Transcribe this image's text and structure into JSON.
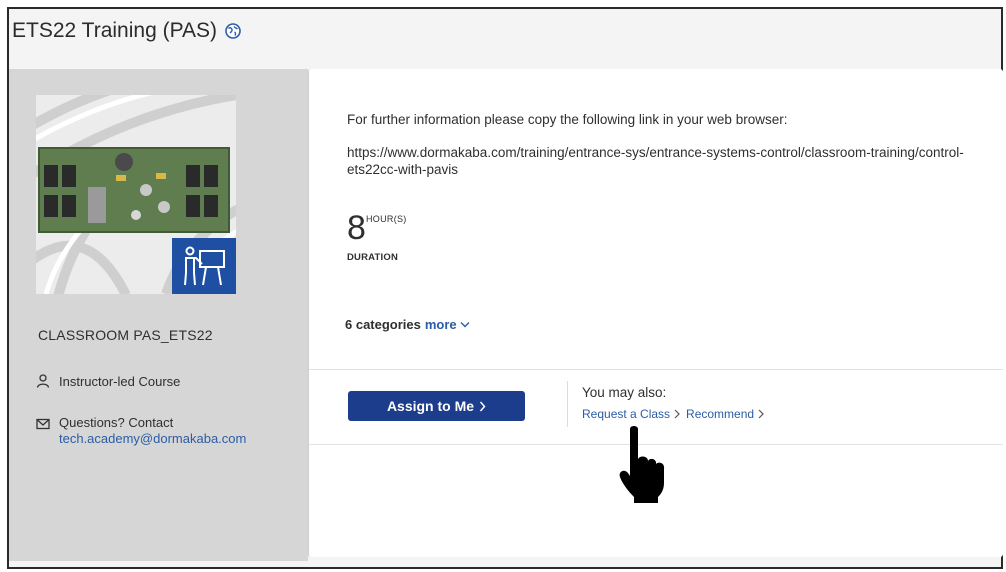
{
  "header": {
    "title": "ETS22 Training (PAS)",
    "icon": "globe-icon"
  },
  "sidebar": {
    "course_id": "CLASSROOM PAS_ETS22",
    "delivery_type": "Instructor-led Course",
    "questions_label": "Questions? Contact",
    "contact_email": "tech.academy@dormakaba.com"
  },
  "main": {
    "info_text": "For further information please copy the following link in your web browser:",
    "link_text": "https://www.dormakaba.com/training/entrance-sys/entrance-systems-control/classroom-training/control-ets22cc-with-pavis",
    "duration_value": "8",
    "duration_unit": "HOUR(S)",
    "duration_label": "DURATION",
    "categories_label": "6 categories",
    "more_label": "more"
  },
  "actions": {
    "assign_label": "Assign to Me",
    "may_also_label": "You may also:",
    "request_label": "Request a Class",
    "recommend_label": "Recommend"
  },
  "colors": {
    "primary_button": "#1b3d8b",
    "link": "#2a5da6",
    "sidebar_bg": "#d6d6d6",
    "page_bg": "#f4f4f4"
  }
}
